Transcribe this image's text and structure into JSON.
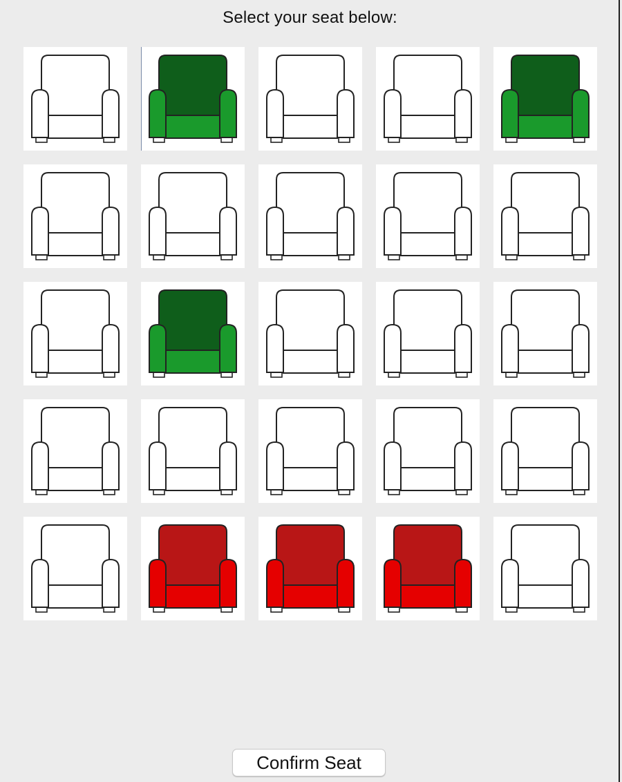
{
  "title": "Select your seat below:",
  "confirm_label": "Confirm Seat",
  "colors": {
    "window_bg": "#ececec",
    "cell_bg": "#ffffff",
    "outline": "#222222",
    "selected_back": "#0f5e1b",
    "selected_body": "#1a9a2c",
    "occupied_back": "#b81616",
    "occupied_body": "#e50000"
  },
  "seats": [
    [
      "available",
      "selected",
      "available",
      "available",
      "selected"
    ],
    [
      "available",
      "available",
      "available",
      "available",
      "available"
    ],
    [
      "available",
      "selected",
      "available",
      "available",
      "available"
    ],
    [
      "available",
      "available",
      "available",
      "available",
      "available"
    ],
    [
      "available",
      "occupied",
      "occupied",
      "occupied",
      "available"
    ]
  ]
}
